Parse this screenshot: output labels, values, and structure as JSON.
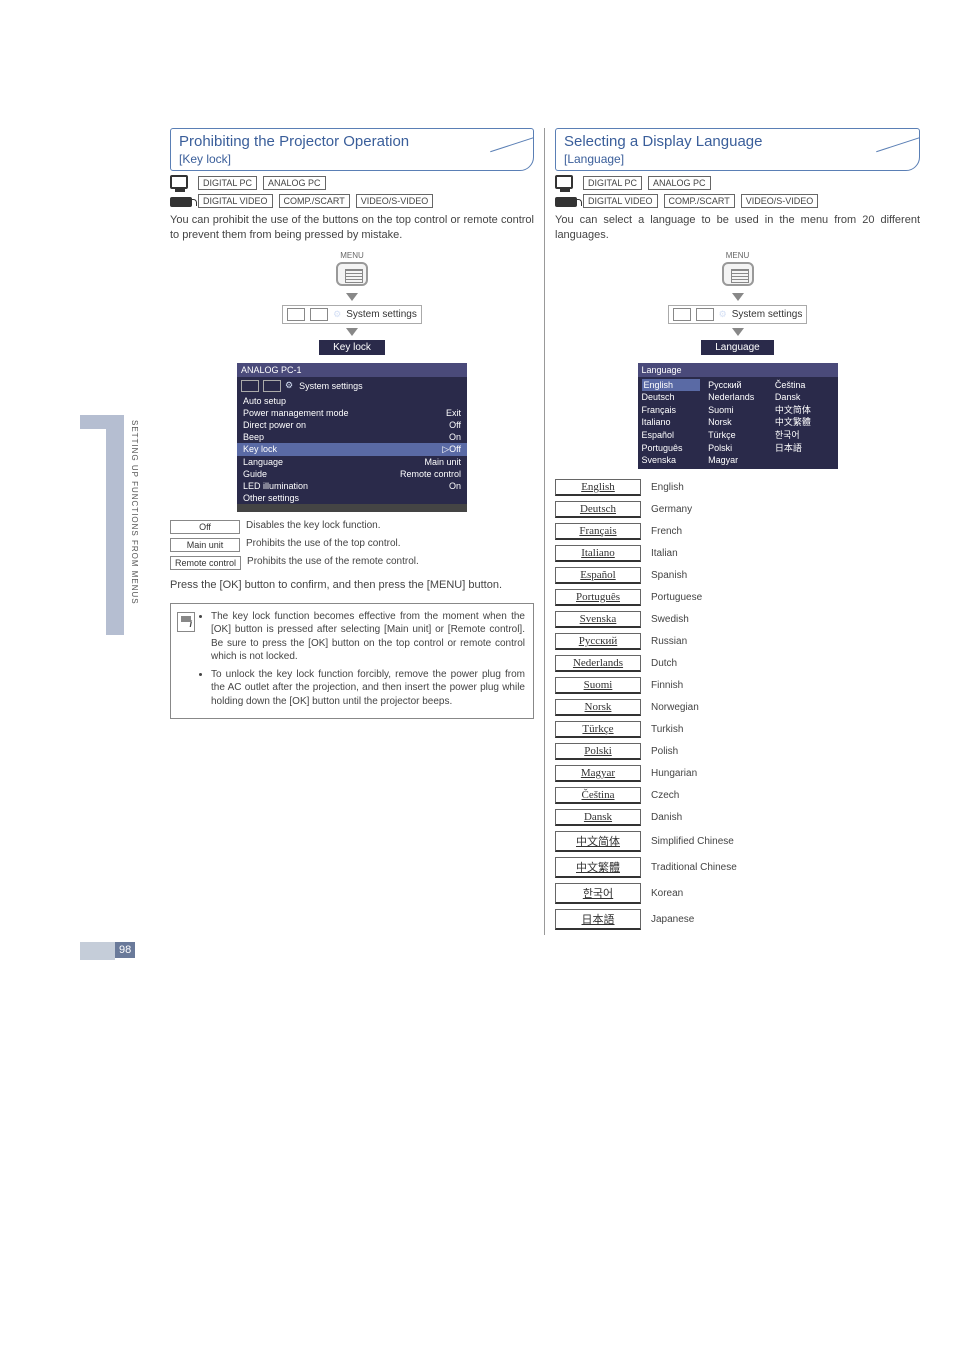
{
  "page_number": "98",
  "side_label": "SETTING UP FUNCTIONS FROM MENUS",
  "left": {
    "title": "Prohibiting the Projector Operation",
    "subtitle": "[Key lock]",
    "src_pc": [
      "DIGITAL PC",
      "ANALOG PC"
    ],
    "src_vid": [
      "DIGITAL VIDEO",
      "COMP./SCART",
      "VIDEO/S-VIDEO"
    ],
    "intro": "You can prohibit the use of the buttons on the top control or remote control to prevent them from being pressed by mistake.",
    "menu_label": "MENU",
    "crumb_label": "System settings",
    "nav_target": "Key lock",
    "osd": {
      "title": "ANALOG PC-1",
      "tab_label": "System settings",
      "rows": [
        {
          "k": "Auto setup",
          "v": ""
        },
        {
          "k": "Power management mode",
          "v": "Exit"
        },
        {
          "k": "Direct power on",
          "v": "Off"
        },
        {
          "k": "Beep",
          "v": "On"
        },
        {
          "k": "Key lock",
          "v": "▷Off",
          "sel": true
        },
        {
          "k": "Language",
          "v": "Main unit"
        },
        {
          "k": "Guide",
          "v": "Remote control"
        },
        {
          "k": "LED illumination",
          "v": "On"
        },
        {
          "k": "Other settings",
          "v": ""
        }
      ]
    },
    "options": [
      {
        "k": "Off",
        "d": "Disables the key lock function."
      },
      {
        "k": "Main unit",
        "d": "Prohibits the use of the top control."
      },
      {
        "k": "Remote control",
        "d": "Prohibits the use of the remote control."
      }
    ],
    "confirm": "Press the [OK] button to confirm, and then press the [MENU] button.",
    "notes": [
      "The key lock function becomes effective from the moment when the [OK] button is pressed after selecting [Main unit] or [Remote control]. Be sure to press the [OK] button on the top control or remote control which is not locked.",
      "To unlock the key lock function forcibly, remove the power plug from the AC outlet after the projection, and then insert the power plug while holding down the [OK] button until the projector beeps."
    ]
  },
  "right": {
    "title": "Selecting a Display Language",
    "subtitle": "[Language]",
    "src_pc": [
      "DIGITAL PC",
      "ANALOG PC"
    ],
    "src_vid": [
      "DIGITAL VIDEO",
      "COMP./SCART",
      "VIDEO/S-VIDEO"
    ],
    "intro": "You can select a language to be used in the menu from 20 different languages.",
    "menu_label": "MENU",
    "crumb_label": "System settings",
    "nav_target": "Language",
    "lang_osd_title": "Language",
    "lang_cols": [
      [
        "English",
        "Deutsch",
        "Français",
        "Italiano",
        "Español",
        "Português",
        "Svenska"
      ],
      [
        "Русский",
        "Nederlands",
        "Suomi",
        "Norsk",
        "Türkçe",
        "Polski",
        "Magyar"
      ],
      [
        "Čeština",
        "Dansk",
        "中文简体",
        "中文繁體",
        "한국어",
        "日本語"
      ]
    ],
    "languages": [
      {
        "btn": "English",
        "desc": "English"
      },
      {
        "btn": "Deutsch",
        "desc": "Germany"
      },
      {
        "btn": "Français",
        "desc": "French"
      },
      {
        "btn": "Italiano",
        "desc": "Italian"
      },
      {
        "btn": "Español",
        "desc": "Spanish"
      },
      {
        "btn": "Português",
        "desc": "Portuguese"
      },
      {
        "btn": "Svenska",
        "desc": "Swedish"
      },
      {
        "btn": "Русский",
        "desc": "Russian"
      },
      {
        "btn": "Nederlands",
        "desc": "Dutch"
      },
      {
        "btn": "Suomi",
        "desc": "Finnish"
      },
      {
        "btn": "Norsk",
        "desc": "Norwegian"
      },
      {
        "btn": "Türkçe",
        "desc": "Turkish"
      },
      {
        "btn": "Polski",
        "desc": "Polish"
      },
      {
        "btn": "Magyar",
        "desc": "Hungarian"
      },
      {
        "btn": "Čeština",
        "desc": "Czech"
      },
      {
        "btn": "Dansk",
        "desc": "Danish"
      },
      {
        "btn": "中文简体",
        "desc": "Simplified Chinese"
      },
      {
        "btn": "中文繁體",
        "desc": "Traditional Chinese"
      },
      {
        "btn": "한국어",
        "desc": "Korean"
      },
      {
        "btn": "日本語",
        "desc": "Japanese"
      }
    ]
  }
}
